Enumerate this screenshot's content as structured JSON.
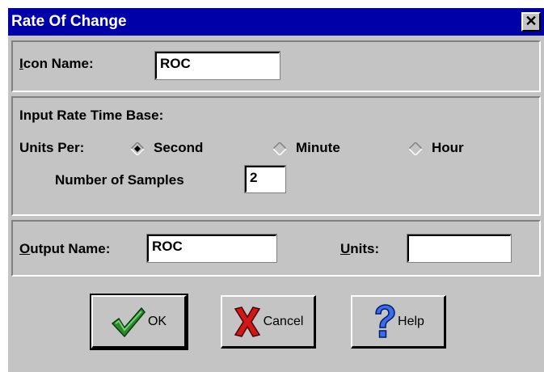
{
  "window": {
    "title": "Rate Of Change",
    "close_glyph": "✕"
  },
  "icon_section": {
    "label_mnemonic": "I",
    "label_rest": "con Name:",
    "value": "ROC"
  },
  "input_section": {
    "heading": "Input Rate Time Base:",
    "units_per_label": "Units Per:",
    "options": [
      {
        "label": "Second",
        "selected": true
      },
      {
        "label": "Minute",
        "selected": false
      },
      {
        "label": "Hour",
        "selected": false
      }
    ],
    "samples_label": "Number of Samples",
    "samples_value": "2"
  },
  "output_section": {
    "name_label_mnemonic": "O",
    "name_label_rest": "utput Name:",
    "name_value": "ROC",
    "units_label_mnemonic": "U",
    "units_label_rest": "nits:",
    "units_value": ""
  },
  "buttons": {
    "ok": {
      "label": "OK",
      "icon": "checkmark-icon"
    },
    "cancel": {
      "label": "Cancel",
      "icon": "red-x-icon"
    },
    "help": {
      "label": "Help",
      "icon": "question-mark-icon"
    }
  },
  "colors": {
    "titlebar": "#0000a8",
    "face": "#c4c4c4"
  }
}
